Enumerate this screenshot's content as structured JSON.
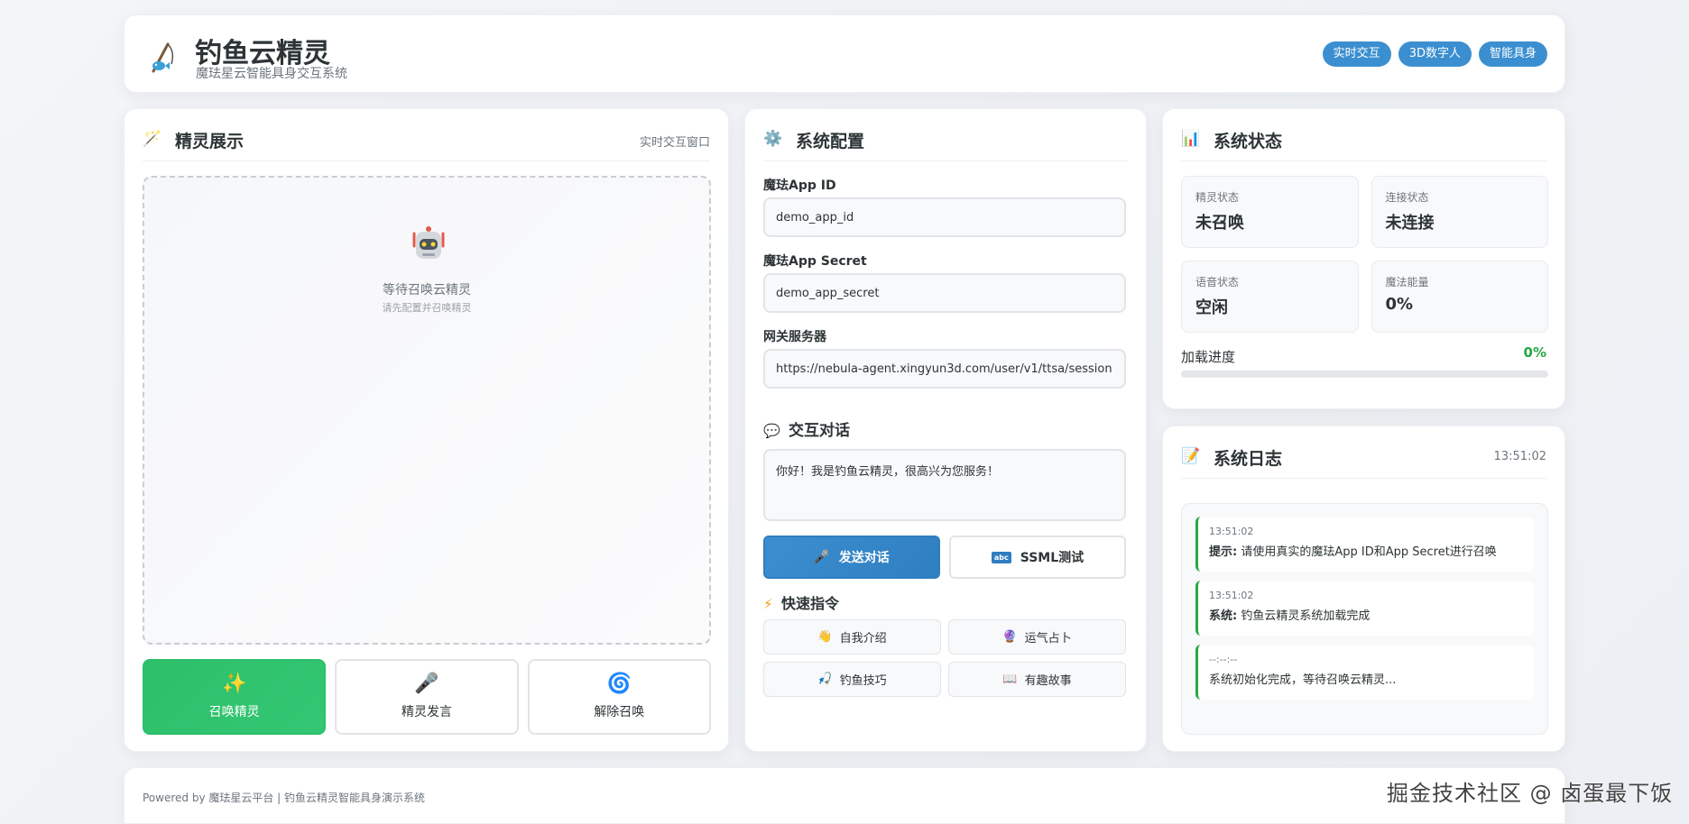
{
  "header": {
    "title": "钓鱼云精灵",
    "subtitle": "魔珐星云智能具身交互系统",
    "badges": [
      "实时交互",
      "3D数字人",
      "智能具身"
    ],
    "accent": "#3b8fd0"
  },
  "spirit_panel": {
    "title": "精灵展示",
    "right_label": "实时交互窗口",
    "placeholder_title": "等待召唤云精灵",
    "placeholder_sub": "请先配置并召唤精灵",
    "actions": [
      {
        "label": "召唤精灵",
        "icon": "sparkles-icon"
      },
      {
        "label": "精灵发言",
        "icon": "microphone-icon"
      },
      {
        "label": "解除召唤",
        "icon": "cyclone-icon"
      }
    ],
    "primary_color": "#2dbf6a"
  },
  "config_panel": {
    "title": "系统配置",
    "app_id_label": "魔珐App ID",
    "app_id_value": "demo_app_id",
    "app_secret_label": "魔珐App Secret",
    "app_secret_value": "demo_app_secret",
    "gateway_label": "网关服务器",
    "gateway_value": "https://nebula-agent.xingyun3d.com/user/v1/ttsa/session",
    "dialog_title": "交互对话",
    "dialog_text": "你好！我是钓鱼云精灵，很高兴为您服务！",
    "send_label": "发送对话",
    "ssml_label": "SSML测试",
    "quick_title": "快速指令",
    "quick_commands": [
      {
        "label": "自我介绍",
        "icon": "hand-icon"
      },
      {
        "label": "运气占卜",
        "icon": "crystal-ball-icon"
      },
      {
        "label": "钓鱼技巧",
        "icon": "fishing-icon"
      },
      {
        "label": "有趣故事",
        "icon": "book-icon"
      }
    ]
  },
  "status_panel": {
    "title": "系统状态",
    "items": [
      {
        "label": "精灵状态",
        "value": "未召唤"
      },
      {
        "label": "连接状态",
        "value": "未连接"
      },
      {
        "label": "语音状态",
        "value": "空闲"
      },
      {
        "label": "魔法能量",
        "value": "0%"
      }
    ],
    "progress_label": "加载进度",
    "progress_value": "0%",
    "progress_fraction": 0,
    "progress_color": "#28a745"
  },
  "log_panel": {
    "title": "系统日志",
    "time": "13:51:02",
    "entries": [
      {
        "time": "13:51:02",
        "tag": "提示:",
        "msg": " 请使用真实的魔珐App ID和App Secret进行召唤"
      },
      {
        "time": "13:51:02",
        "tag": "系统:",
        "msg": " 钓鱼云精灵系统加载完成"
      },
      {
        "time": "--:--:--",
        "tag": "",
        "msg": "系统初始化完成，等待召唤云精灵..."
      }
    ]
  },
  "footer": {
    "text": "Powered by 魔珐星云平台 | 钓鱼云精灵智能具身演示系统",
    "watermark": "掘金技术社区 @ 卤蛋最下饭"
  }
}
